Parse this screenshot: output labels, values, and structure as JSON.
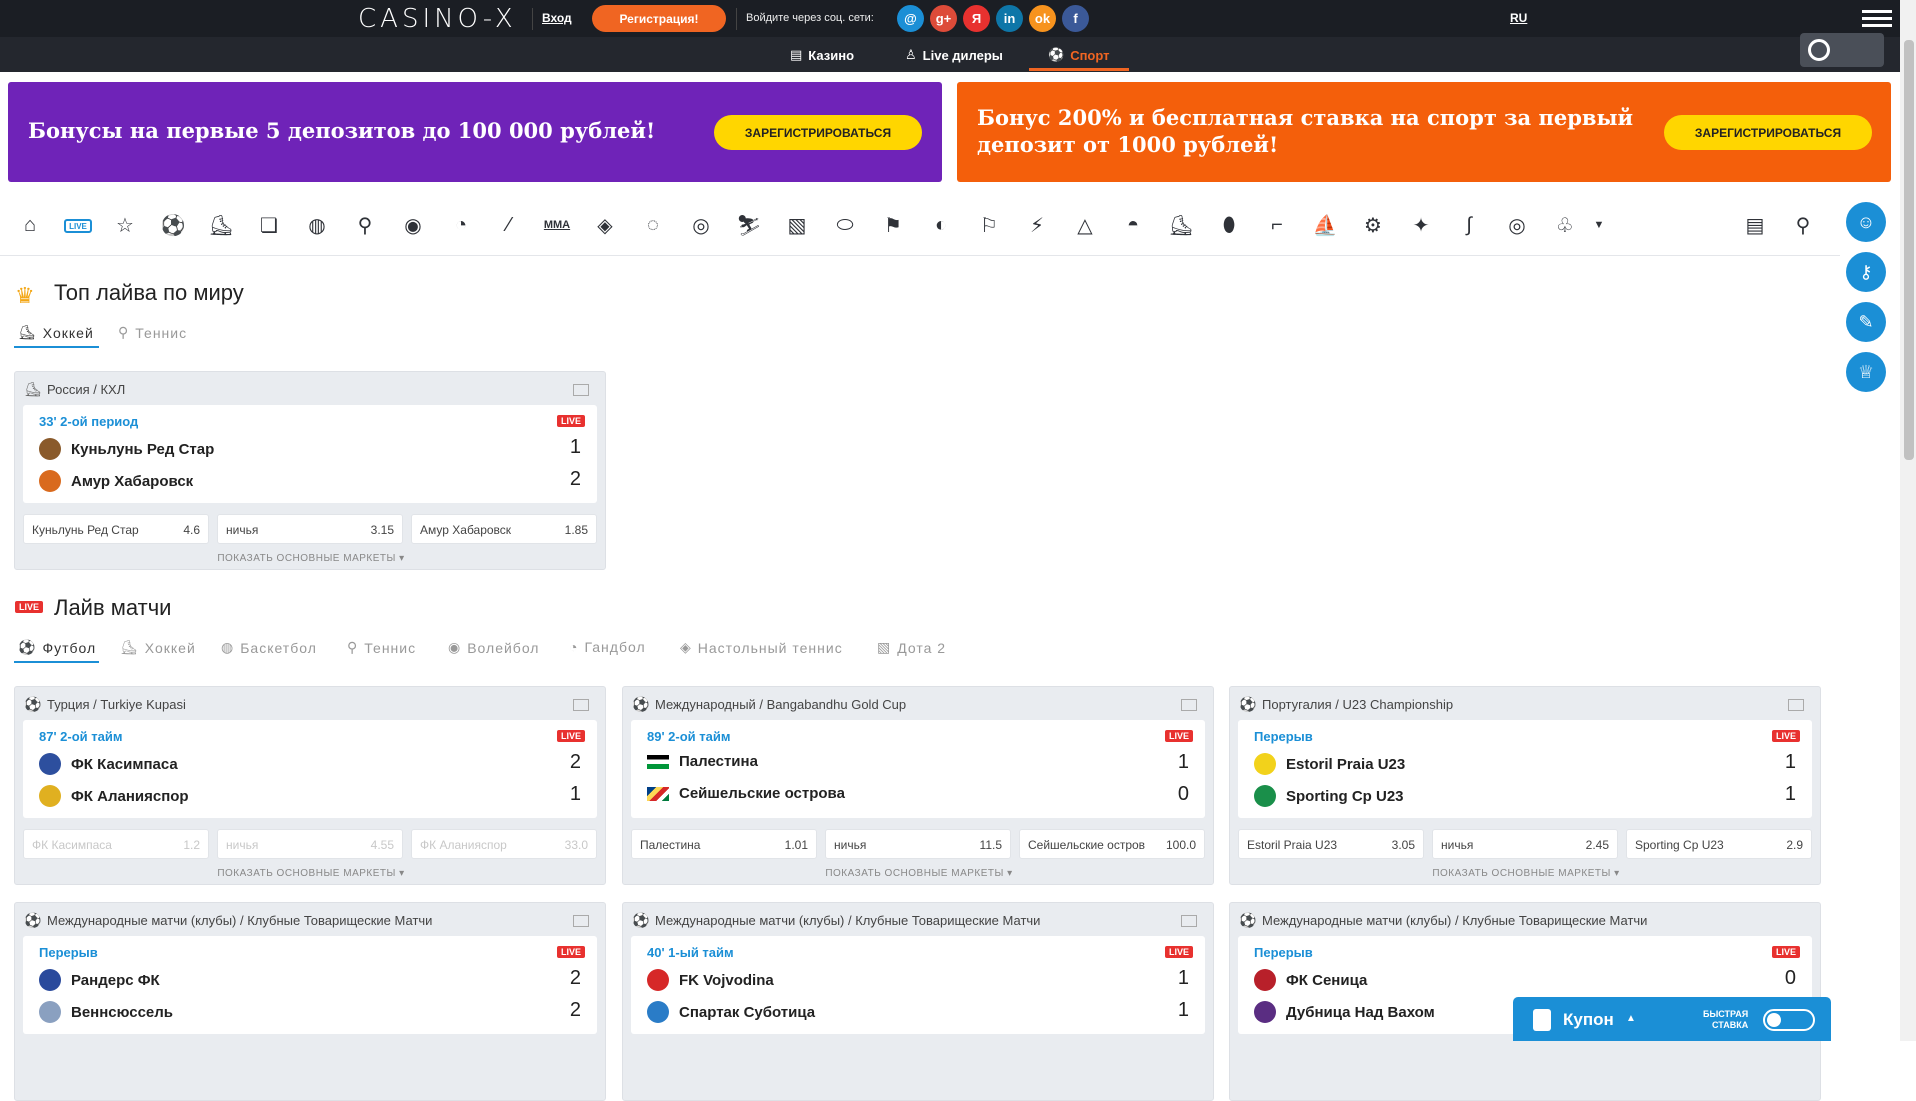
{
  "header": {
    "logo": "CASINO-X",
    "login": "Вход",
    "register": "Регистрация!",
    "social_label": "Войдите через соц. сети:",
    "social": [
      "@",
      "g+",
      "Я",
      "in",
      "ok",
      "f"
    ],
    "social_colors": [
      "#1b8fd6",
      "#dd4b39",
      "#e8312f",
      "#0e76a8",
      "#f7931e",
      "#3b5998"
    ],
    "lang": "RU"
  },
  "subnav": {
    "casino": "Казино",
    "live": "Live дилеры",
    "sport": "Спорт"
  },
  "banners": [
    {
      "text": "Бонусы на первые 5 депозитов до 100 000 рублей!",
      "button": "ЗАРЕГИСТРИРОВАТЬСЯ"
    },
    {
      "text1": "Бонус 200% и бесплатная ставка на спорт за первый",
      "text2": "депозит от 1000 рублей!",
      "button": "ЗАРЕГИСТРИРОВАТЬСЯ"
    }
  ],
  "sportbar": {
    "live": "LIVE",
    "mma": "MMA"
  },
  "top_live": {
    "title": "Топ лайва по миру",
    "tabs": [
      "Хоккей",
      "Теннис"
    ]
  },
  "live_matches": {
    "title": "Лайв матчи",
    "badge": "LIVE",
    "tabs": [
      "Футбол",
      "Хоккей",
      "Баскетбол",
      "Теннис",
      "Волейбол",
      "Гандбол",
      "Настольный теннис",
      "Дота 2"
    ]
  },
  "cards": [
    {
      "league": "Россия / КХЛ",
      "time": "33' 2-ой период",
      "t1": "Куньлунь Ред Стар",
      "t2": "Амур Хабаровск",
      "s1": "1",
      "s2": "2",
      "o1n": "Куньлунь Ред Стар",
      "o1": "4.6",
      "o2n": "ничья",
      "o2": "3.15",
      "o3n": "Амур Хабаровск",
      "o3": "1.85"
    },
    {
      "league": "Турция / Turkiye Kupasi",
      "time": "87' 2-ой тайм",
      "t1": "ФК Касимпаса",
      "t2": "ФК Аланияспор",
      "s1": "2",
      "s2": "1",
      "o1n": "ФК Касимпаса",
      "o1": "1.2",
      "o2n": "ничья",
      "o2": "4.55",
      "o3n": "ФК Аланияспор",
      "o3": "33.0"
    },
    {
      "league": "Международный / Bangabandhu Gold Cup",
      "time": "89' 2-ой тайм",
      "t1": "Палестина",
      "t2": "Сейшельские острова",
      "s1": "1",
      "s2": "0",
      "o1n": "Палестина",
      "o1": "1.01",
      "o2n": "ничья",
      "o2": "11.5",
      "o3n": "Сейшельские остров",
      "o3": "100.0"
    },
    {
      "league": "Португалия / U23 Championship",
      "time": "Перерыв",
      "t1": "Estoril Praia U23",
      "t2": "Sporting Cp U23",
      "s1": "1",
      "s2": "1",
      "o1n": "Estoril Praia U23",
      "o1": "3.05",
      "o2n": "ничья",
      "o2": "2.45",
      "o3n": "Sporting Cp U23",
      "o3": "2.9"
    },
    {
      "league": "Международные матчи (клубы) / Клубные Товарищеские Матчи",
      "time": "Перерыв",
      "t1": "Рандерс ФК",
      "t2": "Веннсюссель",
      "s1": "2",
      "s2": "2"
    },
    {
      "league": "Международные матчи (клубы) / Клубные Товарищеские Матчи",
      "time": "40' 1-ый тайм",
      "t1": "FK Vojvodina",
      "t2": "Спартак Суботица",
      "s1": "1",
      "s2": "1"
    },
    {
      "league": "Международные матчи (клубы) / Клубные Товарищеские Матчи",
      "time": "Перерыв",
      "t1": "ФК Сеница",
      "t2": "Дубница Над Вахом",
      "s1": "0",
      "s2": ""
    }
  ],
  "common": {
    "live": "LIVE",
    "show_more": "ПОКАЗАТЬ ОСНОВНЫЕ МАРКЕТЫ ▾"
  },
  "coupon": {
    "label": "Купон",
    "fast1": "БЫСТРАЯ",
    "fast2": "СТАВКА"
  }
}
